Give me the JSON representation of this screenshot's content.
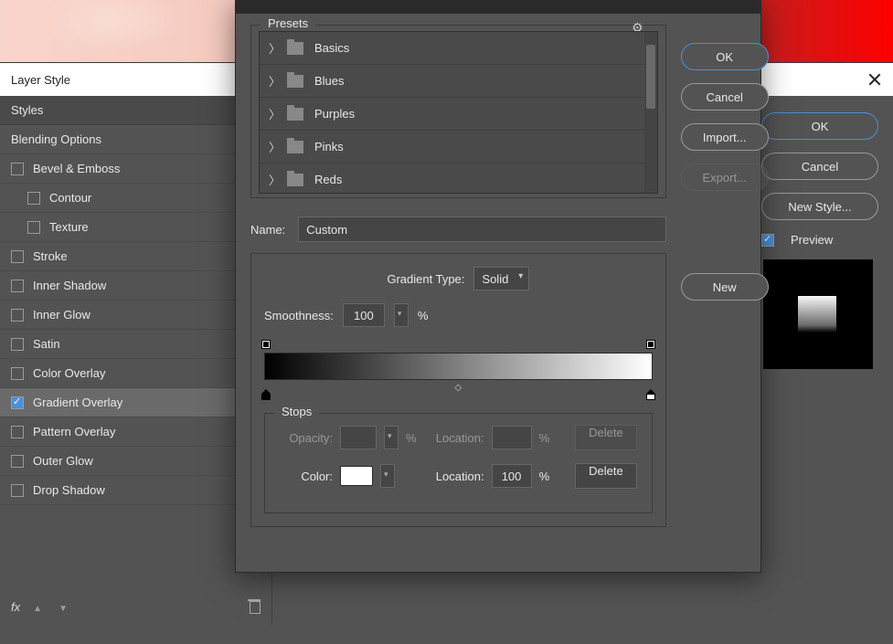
{
  "chart_data": null,
  "layerStyle": {
    "title": "Layer Style",
    "stylesHeader": "Styles",
    "blendingOptions": "Blending Options",
    "effects": {
      "bevelEmboss": "Bevel & Emboss",
      "contour": "Contour",
      "texture": "Texture",
      "stroke": "Stroke",
      "innerShadow": "Inner Shadow",
      "innerGlow": "Inner Glow",
      "satin": "Satin",
      "colorOverlay": "Color Overlay",
      "gradientOverlay": "Gradient Overlay",
      "patternOverlay": "Pattern Overlay",
      "outerGlow": "Outer Glow",
      "dropShadow": "Drop Shadow"
    },
    "checked": {
      "gradientOverlay": true
    },
    "buttons": {
      "ok": "OK",
      "cancel": "Cancel",
      "newStyle": "New Style..."
    },
    "previewLabel": "Preview",
    "fxLabel": "fx"
  },
  "gradEditor": {
    "presetsLabel": "Presets",
    "presetFolders": [
      "Basics",
      "Blues",
      "Purples",
      "Pinks",
      "Reds"
    ],
    "nameLabel": "Name:",
    "nameValue": "Custom",
    "gradTypeLabel": "Gradient Type:",
    "gradTypeValue": "Solid",
    "smoothLabel": "Smoothness:",
    "smoothValue": "100",
    "pct": "%",
    "stopsLabel": "Stops",
    "opacityLabel": "Opacity:",
    "opacityValue": "",
    "opLocLabel": "Location:",
    "opLocValue": "",
    "colorLabel": "Color:",
    "colorSwatch": "#ffffff",
    "colLocLabel": "Location:",
    "colLocValue": "100",
    "deleteLabel": "Delete",
    "buttons": {
      "ok": "OK",
      "cancel": "Cancel",
      "import": "Import...",
      "export": "Export...",
      "new": "New"
    },
    "gradientStops": {
      "opacityStops": [
        {
          "pos": 0,
          "opacity": 100
        },
        {
          "pos": 100,
          "opacity": 100
        }
      ],
      "colorStops": [
        {
          "pos": 0,
          "color": "#000000"
        },
        {
          "pos": 100,
          "color": "#ffffff"
        }
      ],
      "midpoint": 50
    }
  }
}
